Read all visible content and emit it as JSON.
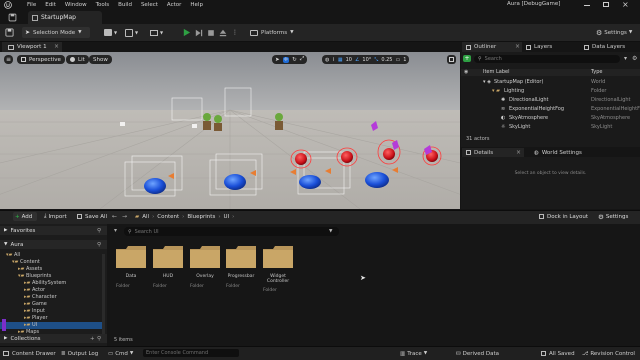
{
  "menu": [
    "File",
    "Edit",
    "Window",
    "Tools",
    "Build",
    "Select",
    "Actor",
    "Help"
  ],
  "project_label": "Aura [DebugGame]",
  "level_tab": "StartupMap",
  "toolbar": {
    "selection_mode": "Selection Mode",
    "platforms": "Platforms",
    "settings": "Settings"
  },
  "viewport": {
    "tab": "Viewport 1",
    "perspective": "Perspective",
    "lit": "Lit",
    "show": "Show",
    "grid_snap": "10",
    "rot_snap": "10°",
    "scale_snap": "0.25",
    "camera_speed": "1"
  },
  "outliner": {
    "tab": "Outliner",
    "layers_tab": "Layers",
    "data_layers_tab": "Data Layers",
    "search_placeholder": "Search",
    "col_label": "Item Label",
    "col_type": "Type",
    "rows": [
      {
        "label": "StartupMap (Editor)",
        "type": "World"
      },
      {
        "label": "Lighting",
        "type": "Folder"
      },
      {
        "label": "DirectionalLight",
        "type": "DirectionalLight"
      },
      {
        "label": "ExponentialHeightFog",
        "type": "ExponentialHeightFog"
      },
      {
        "label": "SkyAtmosphere",
        "type": "SkyAtmosphere"
      },
      {
        "label": "SkyLight",
        "type": "SkyLight"
      }
    ],
    "actor_count": "31 actors"
  },
  "details": {
    "tab": "Details",
    "world_settings_tab": "World Settings",
    "empty_message": "Select an object to view details."
  },
  "content_browser": {
    "add": "Add",
    "import": "Import",
    "save_all": "Save All",
    "breadcrumb": [
      "All",
      "Content",
      "Blueprints",
      "UI"
    ],
    "dock_in_layout": "Dock in Layout",
    "settings": "Settings",
    "favorites": "Favorites",
    "project": "Aura",
    "search_placeholder": "Search UI",
    "collections": "Collections",
    "tree": [
      "All",
      "Content",
      "Assets",
      "Blueprints",
      "AbilitySystem",
      "Actor",
      "Character",
      "Game",
      "Input",
      "Player",
      "UI",
      "Maps"
    ],
    "items": [
      {
        "name": "Data",
        "type": "Folder"
      },
      {
        "name": "HUD",
        "type": "Folder"
      },
      {
        "name": "Overlay",
        "type": "Folder"
      },
      {
        "name": "Progressbar",
        "type": "Folder"
      },
      {
        "name": "Widget Controller",
        "type": "Folder"
      }
    ],
    "item_count": "5 items"
  },
  "statusbar": {
    "content_drawer": "Content Drawer",
    "output_log": "Output Log",
    "cmd": "Cmd",
    "console_placeholder": "Enter Console Command",
    "trace": "Trace",
    "derived_data": "Derived Data",
    "all_saved": "All Saved",
    "revision_control": "Revision Control"
  },
  "colors": {
    "accent_green": "#2ea043",
    "folder": "#c9a667",
    "selection_blue": "#1e4f87"
  }
}
